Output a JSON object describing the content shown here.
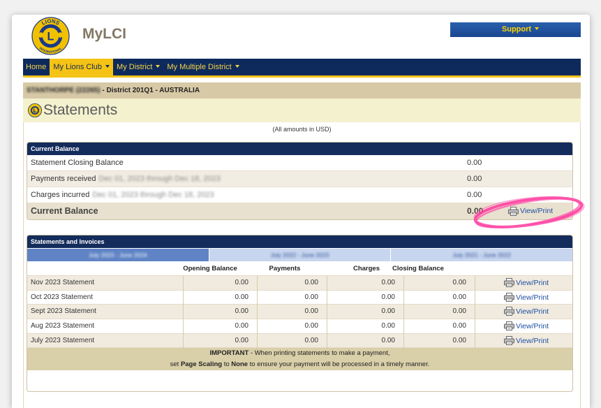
{
  "app": {
    "name": "MyLCI",
    "logo": {
      "top_text": "LIONS",
      "bottom_text": "INTERNATIONAL",
      "letter": "L"
    }
  },
  "header": {
    "support_label": "Support"
  },
  "nav": {
    "items": [
      {
        "label": "Home",
        "dropdown": false,
        "active": false
      },
      {
        "label": "My Lions Club",
        "dropdown": true,
        "active": true
      },
      {
        "label": "My District",
        "dropdown": true,
        "active": false
      },
      {
        "label": "My Multiple District",
        "dropdown": true,
        "active": false
      }
    ]
  },
  "breadcrumb": {
    "club": "STANTHORPE (22265)",
    "district": "- District 201Q1 - AUSTRALIA"
  },
  "page": {
    "title": "Statements",
    "currency_note": "(All amounts in USD)"
  },
  "current_balance": {
    "heading": "Current Balance",
    "rows": [
      {
        "label": "Statement Closing Balance",
        "detail": "",
        "value": "0.00"
      },
      {
        "label": "Payments received",
        "detail": "Dec 01, 2023 through Dec 18, 2023",
        "value": "0.00"
      },
      {
        "label": "Charges incurred",
        "detail": "Dec 01, 2023 through Dec 18, 2023",
        "value": "0.00"
      }
    ],
    "total": {
      "label": "Current Balance",
      "value": "0.00",
      "action": "View/Print"
    }
  },
  "statements": {
    "heading": "Statements and Invoices",
    "tabs": [
      {
        "label": "July 2023 - June 2024",
        "active": true
      },
      {
        "label": "July 2022 - June 2023",
        "active": false
      },
      {
        "label": "July 2021 - June 2022",
        "active": false
      }
    ],
    "columns": [
      "Opening Balance",
      "Payments",
      "Charges",
      "Closing Balance"
    ],
    "rows": [
      {
        "name": "Nov 2023 Statement",
        "opening_balance": "0.00",
        "payments": "0.00",
        "charges": "0.00",
        "closing_balance": "0.00",
        "action": "View/Print"
      },
      {
        "name": "Oct 2023 Statement",
        "opening_balance": "0.00",
        "payments": "0.00",
        "charges": "0.00",
        "closing_balance": "0.00",
        "action": "View/Print"
      },
      {
        "name": "Sept 2023 Statement",
        "opening_balance": "0.00",
        "payments": "0.00",
        "charges": "0.00",
        "closing_balance": "0.00",
        "action": "View/Print"
      },
      {
        "name": "Aug 2023 Statement",
        "opening_balance": "0.00",
        "payments": "0.00",
        "charges": "0.00",
        "closing_balance": "0.00",
        "action": "View/Print"
      },
      {
        "name": "July 2023 Statement",
        "opening_balance": "0.00",
        "payments": "0.00",
        "charges": "0.00",
        "closing_balance": "0.00",
        "action": "View/Print"
      }
    ],
    "notice": {
      "line1_bold": "IMPORTANT",
      "line1_rest": " - When printing statements to make a payment,",
      "line2_pre": "set ",
      "line2_bold1": "Page Scaling",
      "line2_mid": " to ",
      "line2_bold2": "None",
      "line2_rest": " to ensure your payment will be processed in a timely manner."
    }
  },
  "icons": {
    "logo": "lions-logo",
    "title": "lions-emblem-icon",
    "dropdown": "caret-down-icon",
    "print": "printer-icon"
  },
  "colors": {
    "navy": "#0e2a5d",
    "gold": "#f4c315",
    "support_blue": "#1a4690",
    "breadcrumb": "#d7c9a6",
    "title_bar": "#f4f1cf",
    "tab_active": "#5f83c5",
    "tab_inactive": "#c7d5ee",
    "link": "#1f4ea1",
    "highlight": "#ff3d9e"
  }
}
